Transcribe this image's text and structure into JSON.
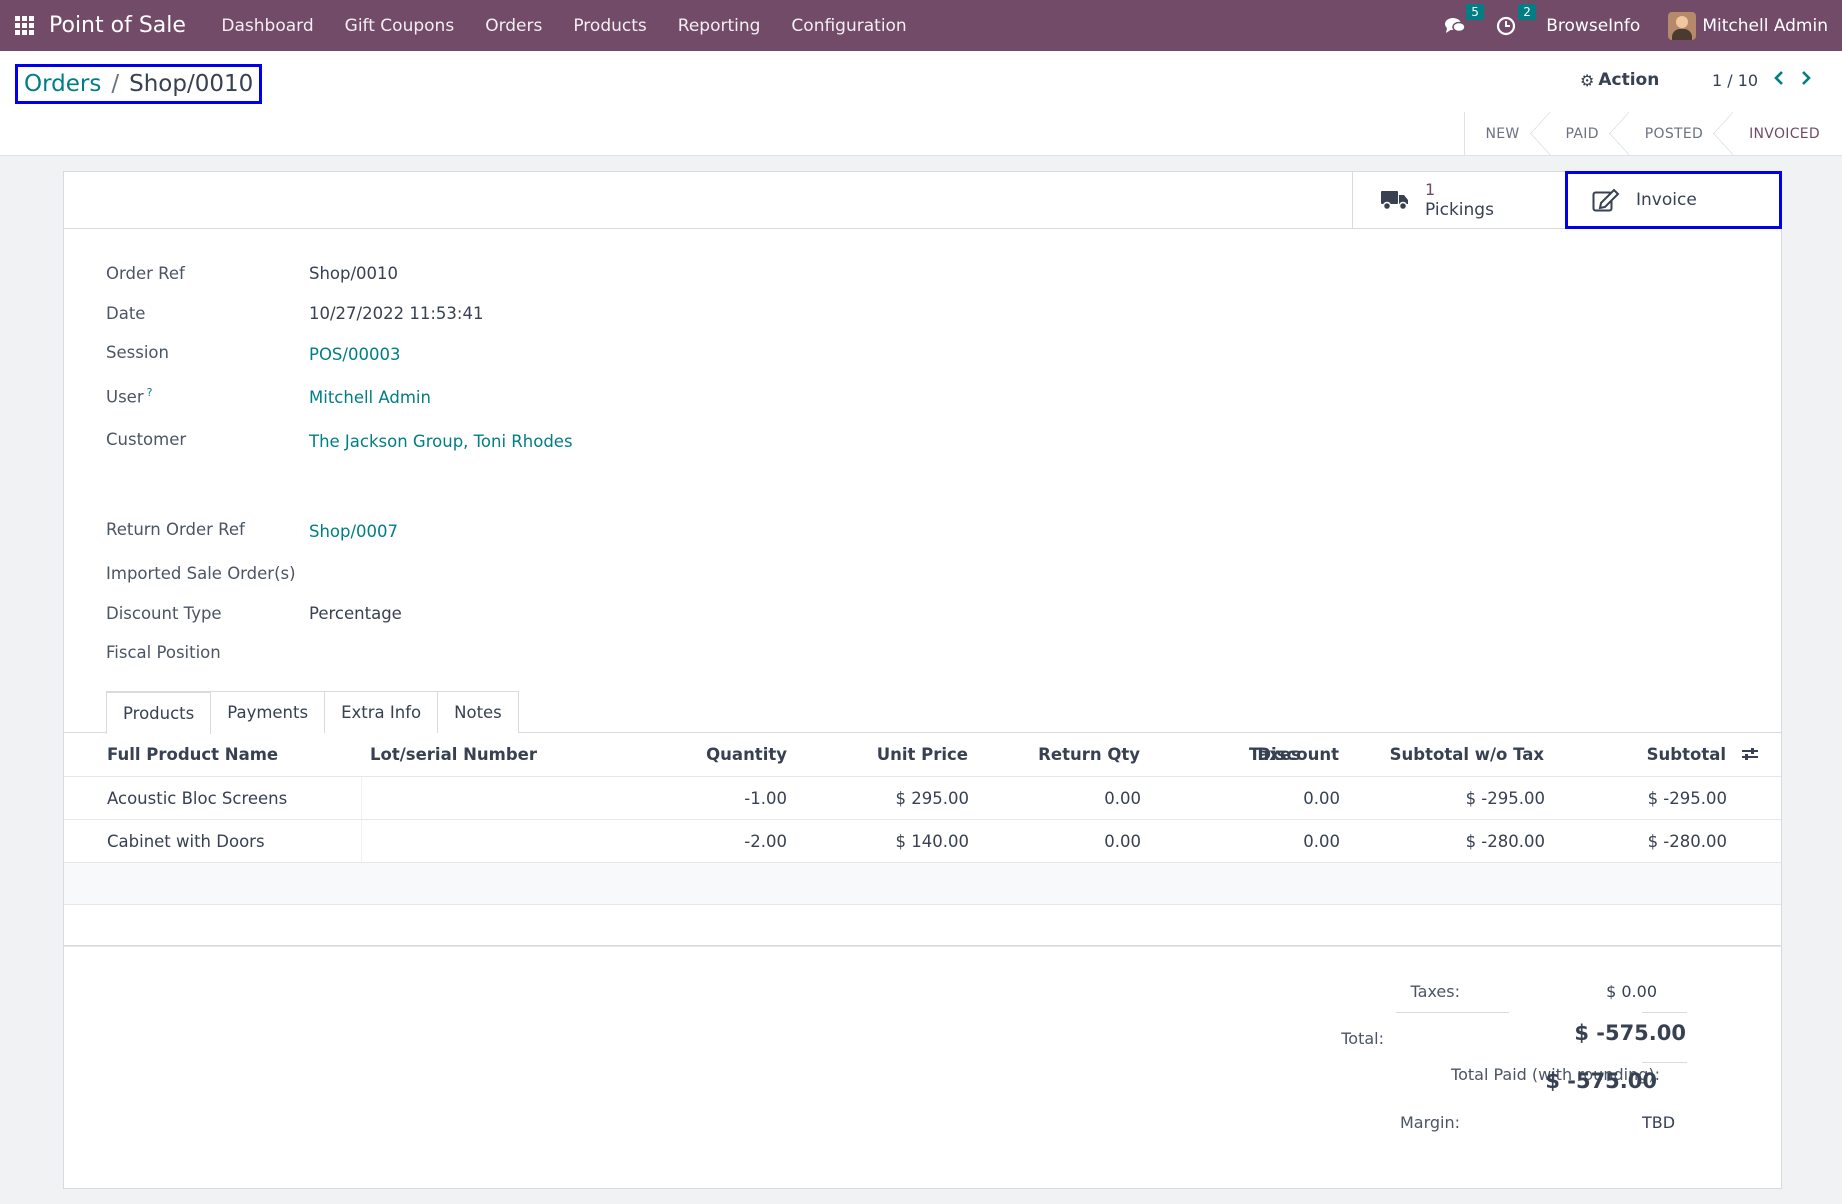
{
  "navbar": {
    "app_name": "Point of Sale",
    "menu": [
      "Dashboard",
      "Gift Coupons",
      "Orders",
      "Products",
      "Reporting",
      "Configuration"
    ],
    "messages_count": "5",
    "activities_count": "2",
    "company": "BrowseInfo",
    "user": "Mitchell Admin"
  },
  "breadcrumb": {
    "parent": "Orders",
    "separator": "/",
    "current": "Shop/0010"
  },
  "control": {
    "action_label": "Action",
    "pager": "1 / 10",
    "stages": [
      "NEW",
      "PAID",
      "POSTED",
      "INVOICED"
    ],
    "active_stage": "INVOICED"
  },
  "smart_buttons": {
    "pickings_count": "1",
    "pickings_label": "Pickings",
    "invoice_label": "Invoice"
  },
  "fields": {
    "order_ref_label": "Order Ref",
    "order_ref": "Shop/0010",
    "date_label": "Date",
    "date": "10/27/2022 11:53:41",
    "session_label": "Session",
    "session": "POS/00003",
    "user_label": "User",
    "user_help": "?",
    "user": "Mitchell Admin",
    "customer_label": "Customer",
    "customer": "The Jackson Group, Toni Rhodes",
    "return_ref_label": "Return Order Ref",
    "return_ref": "Shop/0007",
    "imported_label": "Imported Sale Order(s)",
    "discount_type_label": "Discount Type",
    "discount_type": "Percentage",
    "fiscal_label": "Fiscal Position"
  },
  "tabs": [
    "Products",
    "Payments",
    "Extra Info",
    "Notes"
  ],
  "table": {
    "columns": [
      "Full Product Name",
      "Lot/serial Number",
      "Quantity",
      "Unit Price",
      "Return Qty",
      "Discount",
      "Taxes",
      "Subtotal w/o Tax",
      "Subtotal"
    ],
    "rows": [
      {
        "name": "Acoustic Bloc Screens",
        "lot": "",
        "qty": "-1.00",
        "price": "$ 295.00",
        "return_qty": "0.00",
        "discount": "0.00",
        "taxes": "",
        "subtotal_wo": "$ -295.00",
        "subtotal": "$ -295.00"
      },
      {
        "name": "Cabinet with Doors",
        "lot": "",
        "qty": "-2.00",
        "price": "$ 140.00",
        "return_qty": "0.00",
        "discount": "0.00",
        "taxes": "",
        "subtotal_wo": "$ -280.00",
        "subtotal": "$ -280.00"
      }
    ]
  },
  "totals": {
    "taxes_label": "Taxes:",
    "taxes": "$ 0.00",
    "total_label": "Total:",
    "total": "$ -575.00",
    "paid_label": "Total Paid (with rounding):",
    "paid": "$ -575.00",
    "margin_label": "Margin:",
    "margin": "TBD"
  },
  "colors": {
    "navbar": "#714b67",
    "link": "#017e84",
    "highlight": "#0000ee"
  }
}
